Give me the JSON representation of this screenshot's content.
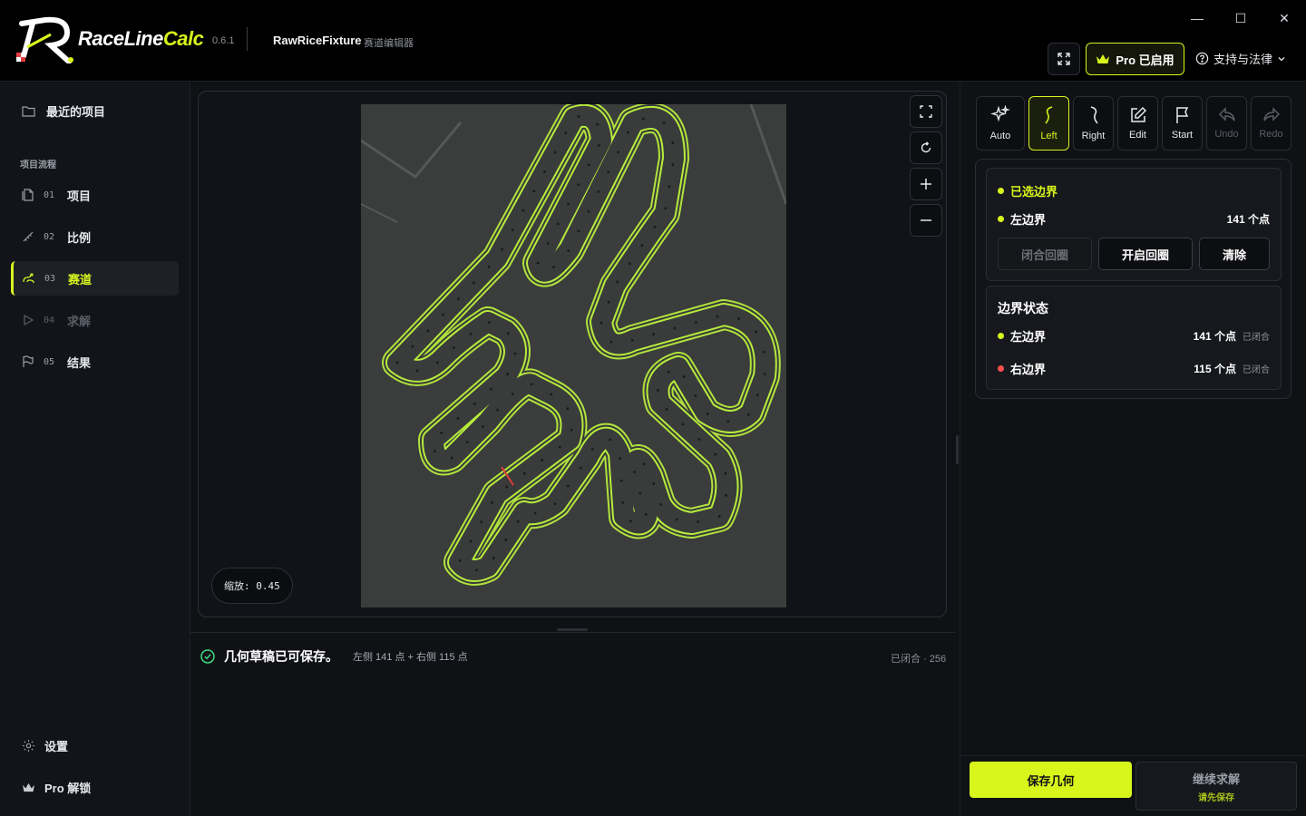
{
  "titlebar": {
    "brand_main": "RaceLine",
    "brand_accent": "Calc",
    "version": "0.6.1",
    "project_name": "RawRiceFixture",
    "project_sub": "赛道编辑器",
    "pro_label": "Pro 已启用",
    "support_label": "支持与法律",
    "window_minimize": "—",
    "window_maximize": "☐",
    "window_close": "✕"
  },
  "sidebar": {
    "recent": "最近的项目",
    "section_label": "项目流程",
    "items": [
      {
        "num": "01",
        "label": "项目"
      },
      {
        "num": "02",
        "label": "比例"
      },
      {
        "num": "03",
        "label": "赛道"
      },
      {
        "num": "04",
        "label": "求解"
      },
      {
        "num": "05",
        "label": "结果"
      }
    ],
    "settings": "设置",
    "pro_unlock": "Pro 解锁"
  },
  "canvas": {
    "zoom": "缩放: 0.45"
  },
  "status": {
    "main": "几何草稿已可保存。",
    "detail": "左侧 141 点 + 右侧 115 点",
    "right": "已闭合 · 256"
  },
  "tools": [
    {
      "label": "Auto"
    },
    {
      "label": "Left"
    },
    {
      "label": "Right"
    },
    {
      "label": "Edit"
    },
    {
      "label": "Start"
    },
    {
      "label": "Undo"
    },
    {
      "label": "Redo"
    }
  ],
  "selection": {
    "title": "已选边界",
    "left_label": "左边界",
    "left_count": "141 个点",
    "btn_close_loop": "闭合回圈",
    "btn_open_loop": "开启回圈",
    "btn_clear": "清除"
  },
  "boundary_status": {
    "title": "边界状态",
    "left_label": "左边界",
    "left_count": "141 个点",
    "left_tag": "已闭合",
    "right_label": "右边界",
    "right_count": "115 个点",
    "right_tag": "已闭合"
  },
  "actions": {
    "save": "保存几何",
    "continue": "继续求解",
    "continue_hint": "请先保存"
  },
  "colors": {
    "accent": "#d8f51c",
    "left_dot": "#d8f51c",
    "right_dot": "#ff4d4d",
    "ok": "#3ddc84"
  }
}
